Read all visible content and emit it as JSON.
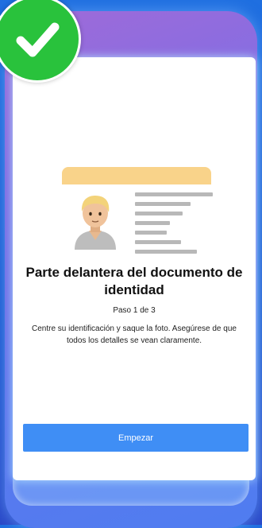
{
  "step_screen": {
    "title": "Parte delantera del documento de identidad",
    "step": "Paso 1 de 3",
    "description": "Centre su identificación y saque la foto. Asegúrese de que todos los detalles se vean claramente.",
    "start_label": "Empezar"
  },
  "badge": {
    "icon": "checkmark-icon",
    "color": "#29c23c"
  },
  "colors": {
    "accent": "#3f8ef5",
    "card_band": "#f9d38a",
    "background": "#1a58d0"
  }
}
